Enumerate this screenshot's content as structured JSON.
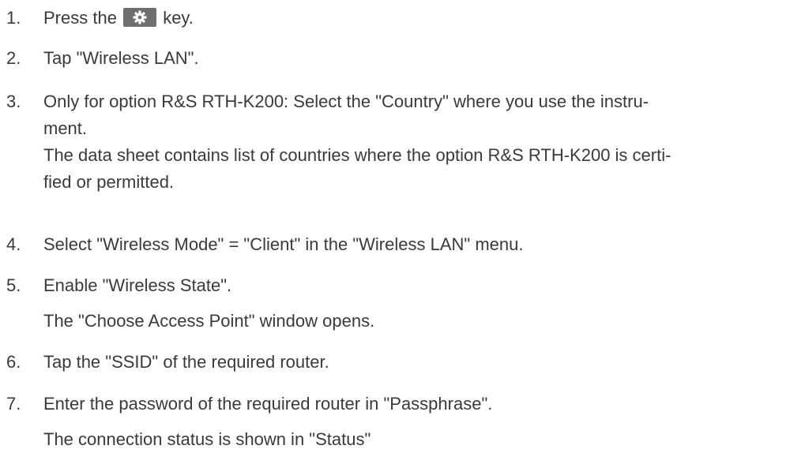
{
  "steps": [
    {
      "number": "1.",
      "before_icon": "Press the",
      "icon": "setup-key-icon",
      "after_icon": "key."
    },
    {
      "number": "2.",
      "text": "Tap \"Wireless LAN\"."
    },
    {
      "number": "3.",
      "line1": "Only for option R&S RTH-K200: Select the \"Country\" where you use the instru-",
      "line2": "ment.",
      "result_line1": "The data sheet contains list of countries where the option R&S RTH-K200 is certi-",
      "result_line2": "fied or permitted."
    },
    {
      "number": "4.",
      "text": "Select \"Wireless Mode\" = \"Client\" in the \"Wireless LAN\" menu."
    },
    {
      "number": "5.",
      "text": "Enable \"Wireless State\".",
      "result": "The \"Choose Access Point\" window opens."
    },
    {
      "number": "6.",
      "text": "Tap the \"SSID\" of the required router."
    },
    {
      "number": "7.",
      "text": "Enter the password of the required router in \"Passphrase\".",
      "result": "The connection status is shown in \"Status\""
    }
  ],
  "colors": {
    "text": "#3a3a3a",
    "key_background": "#6e6e6e",
    "key_symbol": "#ffffff"
  }
}
